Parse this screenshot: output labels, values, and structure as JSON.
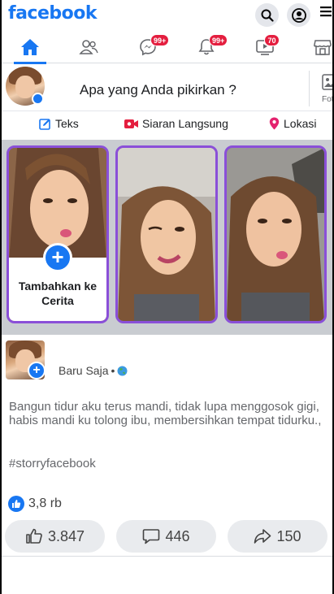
{
  "app": {
    "logo": "facebook"
  },
  "header": {
    "search_icon": "search-icon",
    "profile_icon": "profile-icon",
    "menu_icon": "menu-icon"
  },
  "nav": {
    "tabs": [
      {
        "name": "home",
        "icon": "home-icon",
        "badge": ""
      },
      {
        "name": "friends",
        "icon": "friends-icon",
        "badge": ""
      },
      {
        "name": "messenger",
        "icon": "messenger-icon",
        "badge": "99+"
      },
      {
        "name": "notifications",
        "icon": "bell-icon",
        "badge": "99+"
      },
      {
        "name": "watch",
        "icon": "video-icon",
        "badge": "70"
      },
      {
        "name": "marketplace",
        "icon": "store-icon",
        "badge": ""
      }
    ],
    "accent": "#1877f2",
    "badge_color": "#e41e3f"
  },
  "composer": {
    "prompt": "Apa yang Anda pikirkan ?",
    "photo_label": "Fot"
  },
  "actions": {
    "text": "Teks",
    "live": "Siaran Langsung",
    "location": "Lokasi"
  },
  "stories": {
    "create_label": "Tambahkan ke Cerita",
    "border_color": "#8a4fd8"
  },
  "post": {
    "time": "Baru Saja",
    "separator": "•",
    "body": "Bangun tidur aku terus mandi, tidak lupa menggosok gigi, habis mandi ku tolong ibu, membersihkan tempat tidurku.,",
    "hashtag": "#storryfacebook",
    "reaction_count": "3,8 rb",
    "buttons": {
      "like": "3.847",
      "comment": "446",
      "share": "150"
    }
  }
}
